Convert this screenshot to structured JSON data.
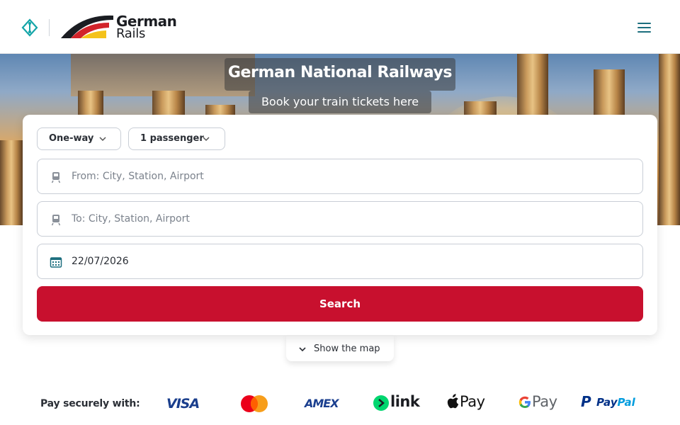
{
  "header": {
    "brand_top": "German",
    "brand_bottom": "Rails",
    "menu_icon": "hamburger-menu-icon",
    "logo_icon": "diamond-route-icon"
  },
  "hero": {
    "title": "German National Railways",
    "subtitle": "Book your train tickets here"
  },
  "booking": {
    "trip_type": "One-way",
    "passengers": "1 passenger",
    "from_placeholder": "From: City, Station, Airport",
    "to_placeholder": "To: City, Station, Airport",
    "date_value": "22/07/2026",
    "search_label": "Search"
  },
  "map_toggle": {
    "label": "Show the map"
  },
  "payment": {
    "label": "Pay securely with:",
    "methods": {
      "visa": "VISA",
      "mastercard": "Mastercard",
      "amex": "AMEX",
      "link": "link",
      "apple_pay": "Pay",
      "google_pay": "Pay",
      "paypal_a": "Pay",
      "paypal_b": "Pal"
    }
  },
  "colors": {
    "accent_teal": "#1c6e7e",
    "primary_red": "#c8102e",
    "border": "#c9ced6",
    "text": "#2b2f36"
  }
}
